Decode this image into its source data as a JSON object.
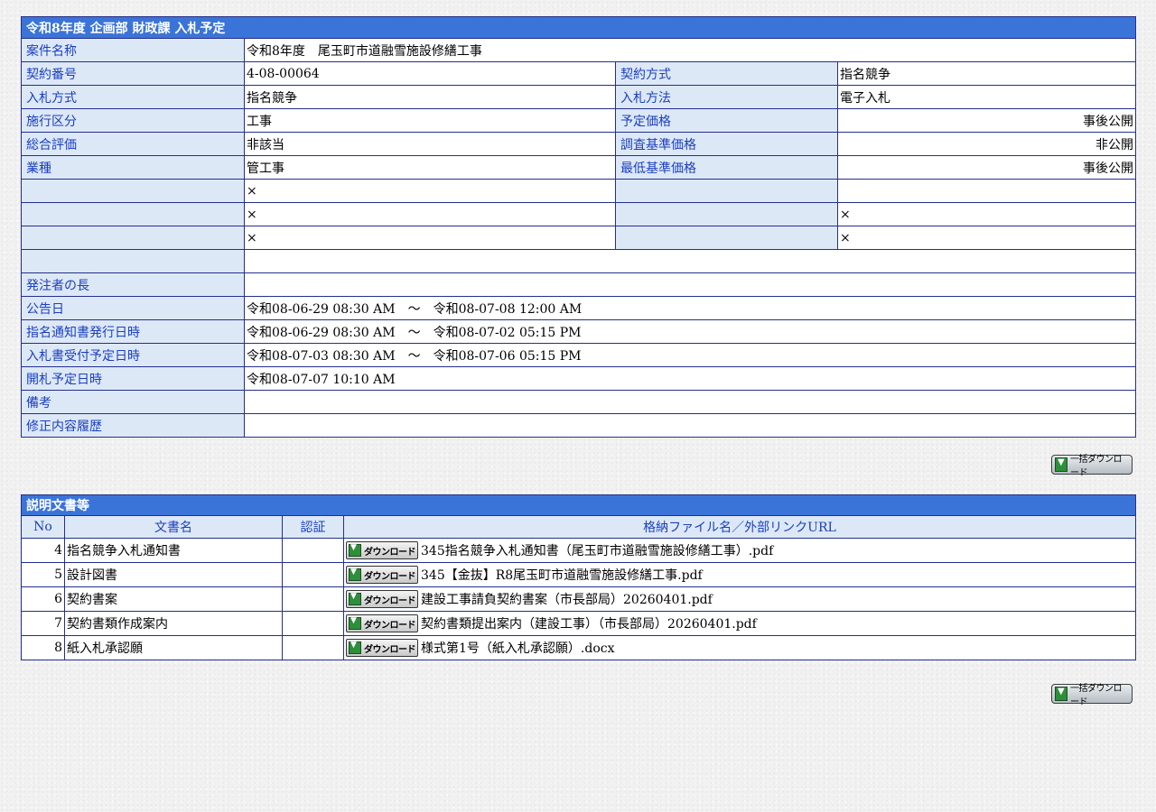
{
  "info": {
    "title": "令和8年度 企画部 財政課 入札予定",
    "project_name_label": "案件名称",
    "project_name": "令和8年度　尾玉町市道融雪施設修繕工事",
    "rows": [
      {
        "l1": "契約番号",
        "v1": "4-08-00064",
        "l2": "契約方式",
        "v2": "指名競争"
      },
      {
        "l1": "入札方式",
        "v1": "指名競争",
        "l2": "入札方法",
        "v2": "電子入札"
      },
      {
        "l1": "施行区分",
        "v1": "工事",
        "l2": "予定価格",
        "v2": "事後公開"
      },
      {
        "l1": "総合評価",
        "v1": "非該当",
        "l2": "調査基準価格",
        "v2": "非公開"
      },
      {
        "l1": "業種",
        "v1": "管工事",
        "l2": "最低基準価格",
        "v2": "事後公開"
      },
      {
        "l1": "",
        "v1": "×",
        "l2": "",
        "v2": ""
      },
      {
        "l1": "",
        "v1": "×",
        "l2": "",
        "v2": "×"
      },
      {
        "l1": "",
        "v1": "×",
        "l2": "",
        "v2": "×"
      }
    ],
    "empty_row_label": "",
    "empty_row_value": "",
    "orderer_label": "発注者の長",
    "orderer_value": "",
    "announce_label": "公告日",
    "announce_value": "令和08-06-29 08:30 AM　～　令和08-07-08 12:00 AM",
    "notice_label": "指名通知書発行日時",
    "notice_value": "令和08-06-29 08:30 AM　～　令和08-07-02 05:15 PM",
    "bid_receipt_label": "入札書受付予定日時",
    "bid_receipt_value": "令和08-07-03 08:30 AM　～　令和08-07-06 05:15 PM",
    "opening_label": "開札予定日時",
    "opening_value": "令和08-07-07 10:10 AM",
    "remarks_label": "備考",
    "remarks_value": "",
    "history_label": "修正内容履歴",
    "history_value": ""
  },
  "bulk_download_label": "一括ダウンロード",
  "docs": {
    "title": "説明文書等",
    "headers": {
      "no": "No",
      "name": "文書名",
      "cert": "認証",
      "file": "格納ファイル名／外部リンクURL"
    },
    "download_label": "ダウンロード",
    "items": [
      {
        "no": "4",
        "name": "指名競争入札通知書",
        "cert": "",
        "file": "345指名競争入札通知書（尾玉町市道融雪施設修繕工事）.pdf"
      },
      {
        "no": "5",
        "name": "設計図書",
        "cert": "",
        "file": "345【金抜】R8尾玉町市道融雪施設修繕工事.pdf"
      },
      {
        "no": "6",
        "name": "契約書案",
        "cert": "",
        "file": "建設工事請負契約書案（市長部局）20260401.pdf"
      },
      {
        "no": "7",
        "name": "契約書類作成案内",
        "cert": "",
        "file": "契約書類提出案内（建設工事）（市長部局）20260401.pdf"
      },
      {
        "no": "8",
        "name": "紙入札承認願",
        "cert": "",
        "file": "様式第1号（紙入札承認願）.docx"
      }
    ]
  }
}
